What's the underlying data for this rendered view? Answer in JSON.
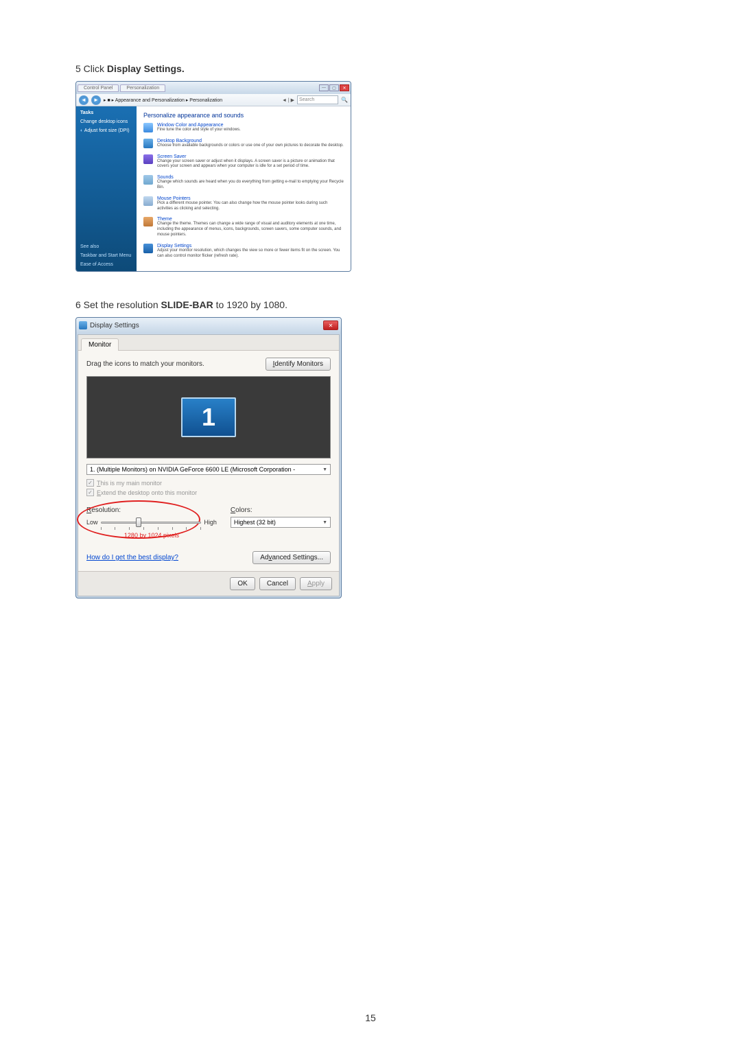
{
  "step5": {
    "prefix": "5 Click ",
    "bold": "Display Settings."
  },
  "vista": {
    "tabs": [
      "Control Panel",
      "Personalization"
    ],
    "nav": {
      "back": "◄",
      "fwd": "►"
    },
    "breadcrumb": "▸ ■ ▸ Appearance and Personalization ▸ Personalization",
    "search_icons": "◄ | ▶",
    "search": "Search",
    "side_header": "Tasks",
    "side_items": [
      "Change desktop icons",
      "Adjust font size (DPI)"
    ],
    "side_footer1": "See also",
    "side_footer2": "Taskbar and Start Menu",
    "side_footer3": "Ease of Access",
    "heading": "Personalize appearance and sounds",
    "items": [
      {
        "title": "Window Color and Appearance",
        "desc": "Fine tune the color and style of your windows."
      },
      {
        "title": "Desktop Background",
        "desc": "Choose from available backgrounds or colors or use one of your own pictures to decorate the desktop."
      },
      {
        "title": "Screen Saver",
        "desc": "Change your screen saver or adjust when it displays. A screen saver is a picture or animation that covers your screen and appears when your computer is idle for a set period of time."
      },
      {
        "title": "Sounds",
        "desc": "Change which sounds are heard when you do everything from getting e-mail to emptying your Recycle Bin."
      },
      {
        "title": "Mouse Pointers",
        "desc": "Pick a different mouse pointer. You can also change how the mouse pointer looks during such activities as clicking and selecting."
      },
      {
        "title": "Theme",
        "desc": "Change the theme. Themes can change a wide range of visual and auditory elements at one time, including the appearance of menus, icons, backgrounds, screen savers, some computer sounds, and mouse pointers."
      },
      {
        "title": "Display Settings",
        "desc": "Adjust your monitor resolution, which changes the view so more or fewer items fit on the screen. You can also control monitor flicker (refresh rate)."
      }
    ]
  },
  "step6": {
    "prefix": "6 Set the resolution ",
    "bold": "SLIDE-BAR",
    "suffix": " to 1920 by 1080."
  },
  "ds": {
    "title": "Display Settings",
    "close": "✕",
    "tab": "Monitor",
    "drag": "Drag the icons to match your monitors.",
    "identify": "Identify Monitors",
    "monitor_num": "1",
    "select": "1. (Multiple Monitors) on NVIDIA GeForce 6600 LE (Microsoft Corporation - ",
    "chk_main_pre": "T",
    "chk_main": "his is my main monitor",
    "chk_ext_pre": "E",
    "chk_ext": "xtend the desktop onto this monitor",
    "res_label_pre": "R",
    "res_label": "esolution:",
    "low": "Low",
    "high": "High",
    "res_value": "1280 by 1024 pixels",
    "colors_label_pre": "C",
    "colors_label": "olors:",
    "colors_val": "Highest (32 bit)",
    "help": "How do I get the best display?",
    "adv_pre": "Ad",
    "adv_u": "v",
    "adv_post": "anced Settings...",
    "ok": "OK",
    "cancel": "Cancel",
    "apply_pre": "A",
    "apply": "pply"
  },
  "page": "15"
}
